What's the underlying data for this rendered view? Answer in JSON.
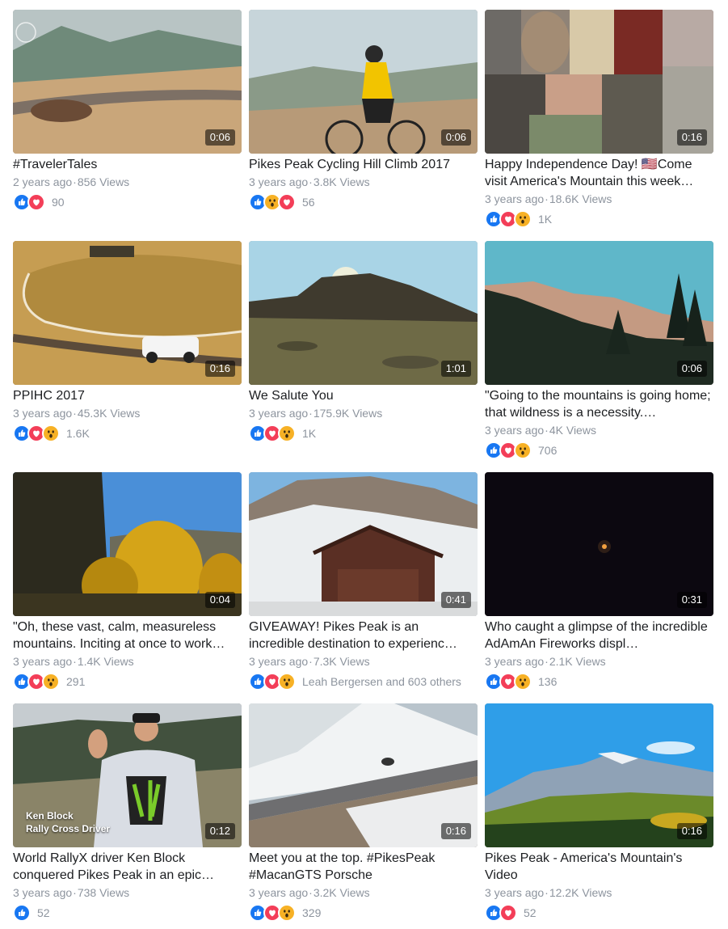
{
  "videos": [
    {
      "title": "#TravelerTales",
      "age": "2 years ago",
      "views": "856 Views",
      "duration": "0:06",
      "reactions": [
        "like",
        "love"
      ],
      "reaction_count": "90"
    },
    {
      "title": "Pikes Peak Cycling Hill Climb 2017",
      "age": "3 years ago",
      "views": "3.8K Views",
      "duration": "0:06",
      "reactions": [
        "like",
        "wow",
        "love"
      ],
      "reaction_count": "56"
    },
    {
      "title": "Happy Independence Day! 🇺🇸Come visit America's Mountain this week…",
      "age": "3 years ago",
      "views": "18.6K Views",
      "duration": "0:16",
      "reactions": [
        "like",
        "love",
        "wow"
      ],
      "reaction_count": "1K"
    },
    {
      "title": "PPIHC 2017",
      "age": "3 years ago",
      "views": "45.3K Views",
      "duration": "0:16",
      "reactions": [
        "like",
        "love",
        "wow"
      ],
      "reaction_count": "1.6K"
    },
    {
      "title": "We Salute You",
      "age": "3 years ago",
      "views": "175.9K Views",
      "duration": "1:01",
      "reactions": [
        "like",
        "love",
        "wow"
      ],
      "reaction_count": "1K"
    },
    {
      "title": "\"Going to the mountains is going home; that wildness is a necessity.…",
      "age": "3 years ago",
      "views": "4K Views",
      "duration": "0:06",
      "reactions": [
        "like",
        "love",
        "wow"
      ],
      "reaction_count": "706"
    },
    {
      "title": "\"Oh, these vast, calm, measureless mountains. Inciting at once to work…",
      "age": "3 years ago",
      "views": "1.4K Views",
      "duration": "0:04",
      "reactions": [
        "like",
        "love",
        "wow"
      ],
      "reaction_count": "291"
    },
    {
      "title": "GIVEAWAY! Pikes Peak is an incredible destination to experienc…",
      "age": "3 years ago",
      "views": "7.3K Views",
      "duration": "0:41",
      "reactions": [
        "like",
        "love",
        "wow"
      ],
      "reaction_count": "Leah Bergersen and 603 others"
    },
    {
      "title": "Who caught a glimpse of the incredible AdAmAn Fireworks displ…",
      "age": "3 years ago",
      "views": "2.1K Views",
      "duration": "0:31",
      "reactions": [
        "like",
        "love",
        "wow"
      ],
      "reaction_count": "136"
    },
    {
      "title": "World RallyX driver Ken Block conquered Pikes Peak in an epic…",
      "age": "3 years ago",
      "views": "738 Views",
      "duration": "0:12",
      "reactions": [
        "like"
      ],
      "reaction_count": "52",
      "overlay": [
        "Ken Block",
        "Rally Cross Driver"
      ]
    },
    {
      "title": "Meet you at the top. #PikesPeak #MacanGTS Porsche",
      "age": "3 years ago",
      "views": "3.2K Views",
      "duration": "0:16",
      "reactions": [
        "like",
        "love",
        "wow"
      ],
      "reaction_count": "329"
    },
    {
      "title": "Pikes Peak - America's Mountain's Video",
      "age": "3 years ago",
      "views": "12.2K Views",
      "duration": "0:16",
      "reactions": [
        "like",
        "love"
      ],
      "reaction_count": "52"
    }
  ],
  "separator": "·",
  "colors": {
    "like": "#1877f2",
    "love": "#f33e58",
    "wow": "#f7b125",
    "meta": "#8d949e"
  }
}
